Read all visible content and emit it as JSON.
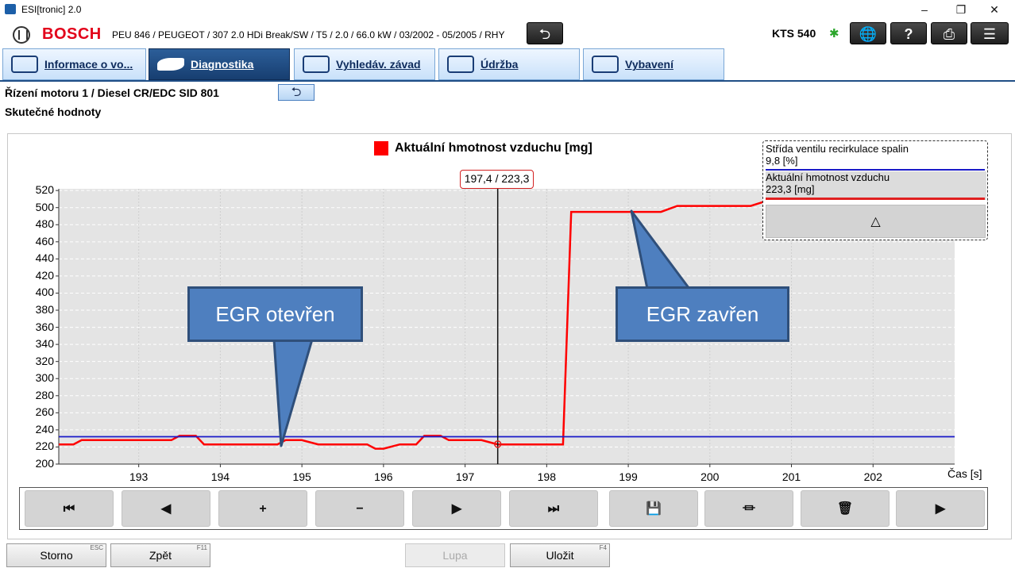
{
  "window": {
    "title": "ESI[tronic] 2.0",
    "controls": [
      "–",
      "❐",
      "✕"
    ]
  },
  "header": {
    "brand": "BOSCH",
    "vehicle": "PEU 846 / PEUGEOT / 307 2.0 HDi Break/SW / T5 / 2.0 / 66.0 kW / 03/2002 - 05/2005 / RHY",
    "device": "KTS 540"
  },
  "tabs": [
    {
      "label": "Informace o vo...",
      "active": false
    },
    {
      "label": "Diagnostika",
      "active": true
    },
    {
      "label": "Vyhledáv. závad",
      "active": false
    },
    {
      "label": "Údržba",
      "active": false
    },
    {
      "label": "Vybavení",
      "active": false
    }
  ],
  "breadcrumb": {
    "ecu": "Řízení motoru 1 / Diesel CR/EDC SID 801",
    "subtitle": "Skutečné hodnoty"
  },
  "chart_data": {
    "type": "line",
    "title": "Aktuální hmotnost vzduchu [mg]",
    "xlabel": "Čas [s]",
    "ylabel": "",
    "xlim": [
      192.02,
      203.0
    ],
    "ylim": [
      200,
      522
    ],
    "yticks": [
      "200",
      "220",
      "240",
      "260",
      "280",
      "300",
      "320",
      "340",
      "360",
      "380",
      "400",
      "420",
      "440",
      "460",
      "480",
      "500",
      "520"
    ],
    "xticks": [
      "193",
      "194",
      "195",
      "196",
      "197",
      "198",
      "199",
      "200",
      "201",
      "202"
    ],
    "grid": true,
    "legend": "top-center",
    "cursor": {
      "x": 197.4,
      "y": 223.3,
      "label": "197,4 / 223,3"
    },
    "series": [
      {
        "name": "Aktuální hmotnost vzduchu",
        "color": "#ff0000",
        "x": [
          192.02,
          192.2,
          192.3,
          193.0,
          193.3,
          193.4,
          193.5,
          193.7,
          193.8,
          194.0,
          194.6,
          194.7,
          194.8,
          195.0,
          195.2,
          195.8,
          195.9,
          196.0,
          196.2,
          196.3,
          196.4,
          196.5,
          196.7,
          196.8,
          197.0,
          197.1,
          197.2,
          197.4,
          198.0,
          198.2,
          198.3,
          198.5,
          199.0,
          199.4,
          199.6,
          199.8,
          200.2,
          200.5,
          200.7
        ],
        "y": [
          223,
          223,
          228,
          228,
          228,
          228,
          233,
          233,
          223,
          223,
          223,
          223,
          228,
          228,
          223,
          223,
          218,
          218,
          223,
          223,
          223,
          233,
          233,
          228,
          228,
          228,
          228,
          223,
          223,
          223,
          495,
          495,
          495,
          495,
          502,
          502,
          502,
          502,
          508
        ]
      },
      {
        "name": "Střída ventilu recirkulace spalin",
        "color": "#1a1ac8",
        "x": [
          192.02,
          203.0
        ],
        "y": [
          232,
          232
        ]
      }
    ]
  },
  "info_box": {
    "items": [
      {
        "name": "Střída ventilu recirkulace spalin",
        "value": "9,8 [%]",
        "color": "#1a1ac8"
      },
      {
        "name": "Aktuální hmotnost vzduchu",
        "value": "223,3 [mg]",
        "color": "#e02020"
      }
    ],
    "scroll_glyph": "△"
  },
  "callouts": [
    {
      "text": "EGR otevřen"
    },
    {
      "text": "EGR zavřen"
    }
  ],
  "toolbar": {
    "buttons": [
      {
        "name": "go-start",
        "glyph": "⏮"
      },
      {
        "name": "step-back",
        "glyph": "◀"
      },
      {
        "name": "zoom-in",
        "glyph": "+"
      },
      {
        "name": "zoom-out",
        "glyph": "−"
      },
      {
        "name": "step-forward",
        "glyph": "▶"
      },
      {
        "name": "go-end",
        "glyph": "⏭"
      },
      {
        "name": "save",
        "glyph": "💾"
      },
      {
        "name": "chart-settings",
        "glyph": "⏛"
      },
      {
        "name": "delete",
        "glyph": "🗑"
      },
      {
        "name": "play",
        "glyph": "▶"
      }
    ]
  },
  "footer": {
    "storno": {
      "label": "Storno",
      "key": "ESC"
    },
    "zpet": {
      "label": "Zpět",
      "key": "F11"
    },
    "lupa": {
      "label": "Lupa",
      "key": ""
    },
    "ulozit": {
      "label": "Uložit",
      "key": "F4"
    }
  }
}
